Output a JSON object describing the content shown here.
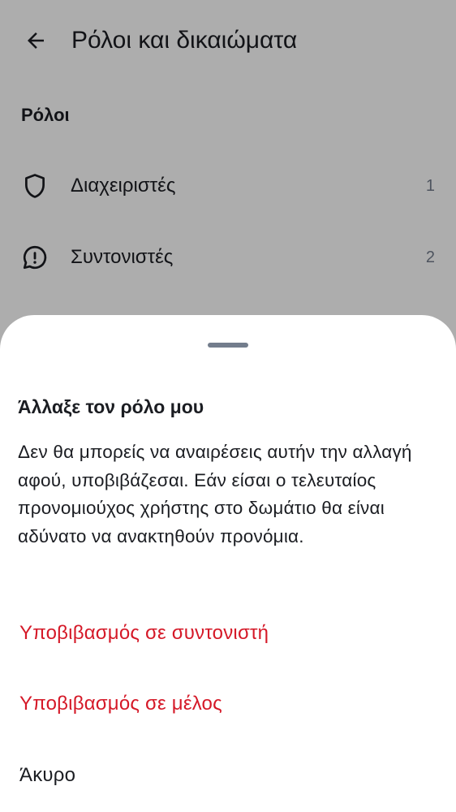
{
  "header": {
    "back_icon": "arrow-left-icon",
    "title": "Ρόλοι και δικαιώματα"
  },
  "roles_section": {
    "title": "Ρόλοι",
    "items": [
      {
        "icon": "shield-icon",
        "label": "Διαχειριστές",
        "count": "1"
      },
      {
        "icon": "chat-alert-icon",
        "label": "Συντονιστές",
        "count": "2"
      }
    ]
  },
  "sheet": {
    "title": "Άλλαξε τον ρόλο μου",
    "description": "Δεν θα μπορείς να αναιρέσεις αυτήν την αλλαγή αφού, υποβιβάζεσαι. Εάν είσαι ο τελευταίος προνομιούχος χρήστης στο δωμάτιο θα είναι αδύνατο να ανακτηθούν προνόμια.",
    "actions": [
      {
        "label": "Υποβιβασμός σε συντονιστή",
        "style": "danger"
      },
      {
        "label": "Υποβιβασμός σε μέλος",
        "style": "danger"
      },
      {
        "label": "Άκυρο",
        "style": "neutral"
      }
    ]
  },
  "colors": {
    "danger": "#d51928",
    "text_primary": "#1b1d22",
    "text_secondary": "#737d8c"
  }
}
